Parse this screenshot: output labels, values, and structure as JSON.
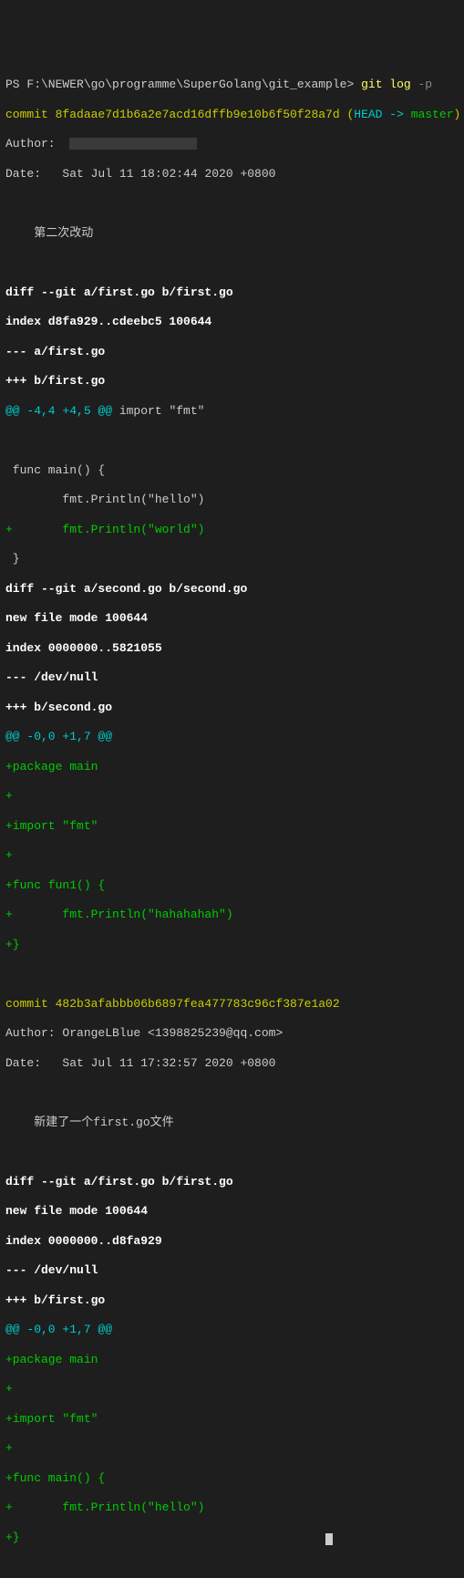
{
  "prompt": {
    "prefix": "PS ",
    "path": "F:\\NEWER\\go\\programme\\SuperGolang\\git_example",
    "gt": ">",
    "command": "git log",
    "arg": " -p"
  },
  "commits": [
    {
      "label": "commit ",
      "hash": "8fadaae7d1b6a2e7acd16dffb9e10b6f50f28a7d",
      "paren_open": " (",
      "head": "HEAD ->",
      "branch": " master",
      "paren_close": ")",
      "author_label": "Author:  ",
      "date_label": "Date:   ",
      "date": "Sat Jul 11 18:02:44 2020 +0800",
      "message": "    第二次改动",
      "diffs": [
        {
          "headers": [
            "diff --git a/first.go b/first.go",
            "index d8fa929..cdeebc5 100644",
            "--- a/first.go",
            "+++ b/first.go"
          ],
          "hunk_marker": "@@ -4,4 +4,5 @@",
          "hunk_ctx": " import \"fmt\"",
          "lines": [
            {
              "type": "ctx",
              "text": ""
            },
            {
              "type": "ctx",
              "text": " func main() {"
            },
            {
              "type": "ctx",
              "text": "        fmt.Println(\"hello\")"
            },
            {
              "type": "add",
              "text": "+       fmt.Println(\"world\")"
            },
            {
              "type": "ctx",
              "text": " }"
            }
          ]
        },
        {
          "headers": [
            "diff --git a/second.go b/second.go",
            "new file mode 100644",
            "index 0000000..5821055",
            "--- /dev/null",
            "+++ b/second.go"
          ],
          "hunk_marker": "@@ -0,0 +1,7 @@",
          "hunk_ctx": "",
          "lines": [
            {
              "type": "add",
              "text": "+package main"
            },
            {
              "type": "add",
              "text": "+"
            },
            {
              "type": "add",
              "text": "+import \"fmt\""
            },
            {
              "type": "add",
              "text": "+"
            },
            {
              "type": "add",
              "text": "+func fun1() {"
            },
            {
              "type": "add",
              "text": "+       fmt.Println(\"hahahahah\")"
            },
            {
              "type": "add",
              "text": "+}"
            }
          ]
        }
      ]
    },
    {
      "label": "commit ",
      "hash": "482b3afabbb06b6897fea477783c96cf387e1a02",
      "author_label": "Author: ",
      "author": "OrangeLBlue <1398825239@qq.com>",
      "date_label": "Date:   ",
      "date": "Sat Jul 11 17:32:57 2020 +0800",
      "message": "    新建了一个first.go文件",
      "diffs": [
        {
          "headers": [
            "diff --git a/first.go b/first.go",
            "new file mode 100644",
            "index 0000000..d8fa929",
            "--- /dev/null",
            "+++ b/first.go"
          ],
          "hunk_marker": "@@ -0,0 +1,7 @@",
          "hunk_ctx": "",
          "lines": [
            {
              "type": "add",
              "text": "+package main"
            },
            {
              "type": "add",
              "text": "+"
            },
            {
              "type": "add",
              "text": "+import \"fmt\""
            },
            {
              "type": "add",
              "text": "+"
            },
            {
              "type": "add",
              "text": "+func main() {"
            },
            {
              "type": "add",
              "text": "+       fmt.Println(\"hello\")"
            },
            {
              "type": "add",
              "text": "+}"
            }
          ]
        }
      ]
    }
  ]
}
